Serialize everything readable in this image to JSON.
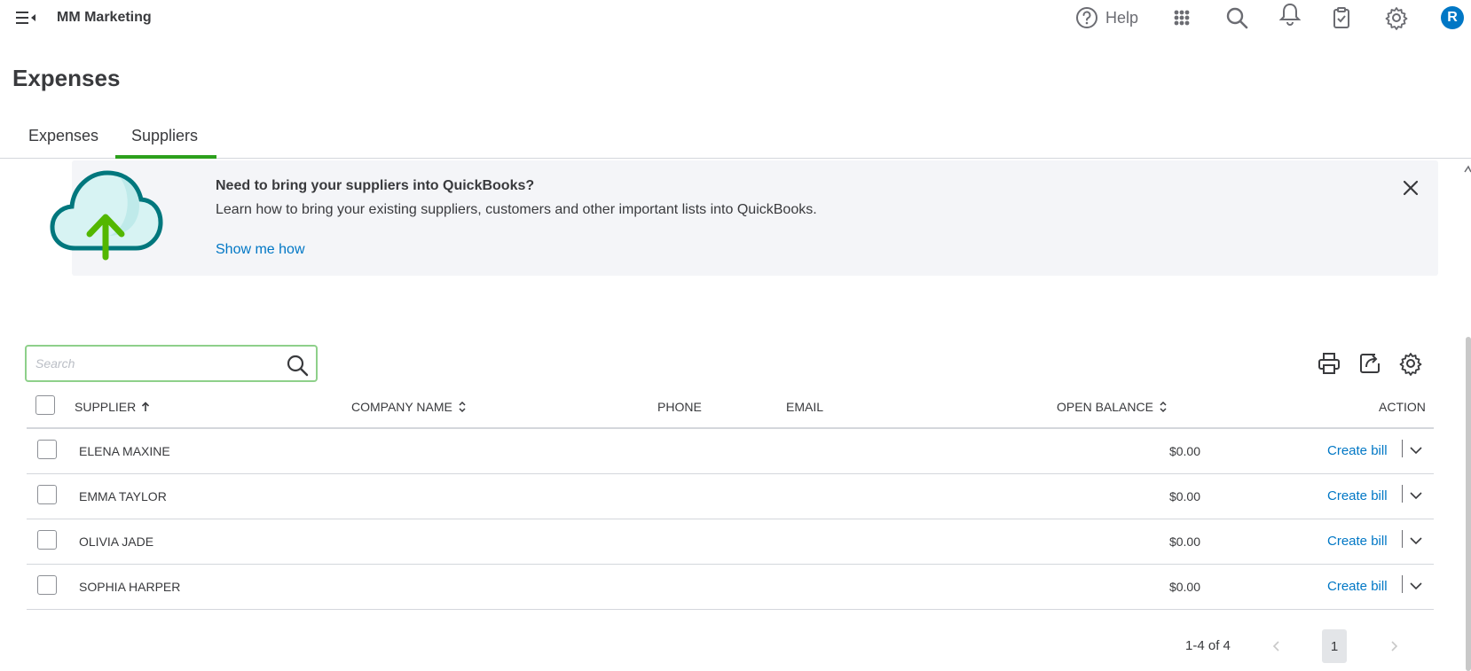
{
  "header": {
    "company_name": "MM Marketing",
    "help_label": "Help",
    "avatar_initial": "R",
    "icons": [
      "menu-collapse-icon",
      "help-icon",
      "apps-grid-icon",
      "search-icon",
      "bell-icon",
      "clipboard-icon",
      "gear-icon"
    ]
  },
  "page": {
    "title": "Expenses",
    "tabs": [
      {
        "label": "Expenses",
        "active": false
      },
      {
        "label": "Suppliers",
        "active": true
      }
    ]
  },
  "banner": {
    "title": "Need to bring your suppliers into QuickBooks?",
    "text": "Learn how to bring your existing suppliers, customers and other important lists into QuickBooks.",
    "link": "Show me how"
  },
  "search": {
    "placeholder": "Search",
    "value": ""
  },
  "table": {
    "columns": {
      "supplier": "SUPPLIER",
      "company": "COMPANY NAME",
      "phone": "PHONE",
      "email": "EMAIL",
      "balance": "OPEN BALANCE",
      "action": "ACTION"
    },
    "rows": [
      {
        "supplier": "ELENA MAXINE",
        "company": "",
        "phone": "",
        "email": "",
        "balance": "$0.00",
        "action": "Create bill"
      },
      {
        "supplier": "EMMA TAYLOR",
        "company": "",
        "phone": "",
        "email": "",
        "balance": "$0.00",
        "action": "Create bill"
      },
      {
        "supplier": "OLIVIA JADE",
        "company": "",
        "phone": "",
        "email": "",
        "balance": "$0.00",
        "action": "Create bill"
      },
      {
        "supplier": "SOPHIA HARPER",
        "company": "",
        "phone": "",
        "email": "",
        "balance": "$0.00",
        "action": "Create bill"
      }
    ]
  },
  "pagination": {
    "range": "1-4 of 4",
    "current_page": "1"
  },
  "colors": {
    "accent_green": "#2ca01c",
    "link_blue": "#0077c5",
    "banner_bg": "#f4f5f8"
  }
}
